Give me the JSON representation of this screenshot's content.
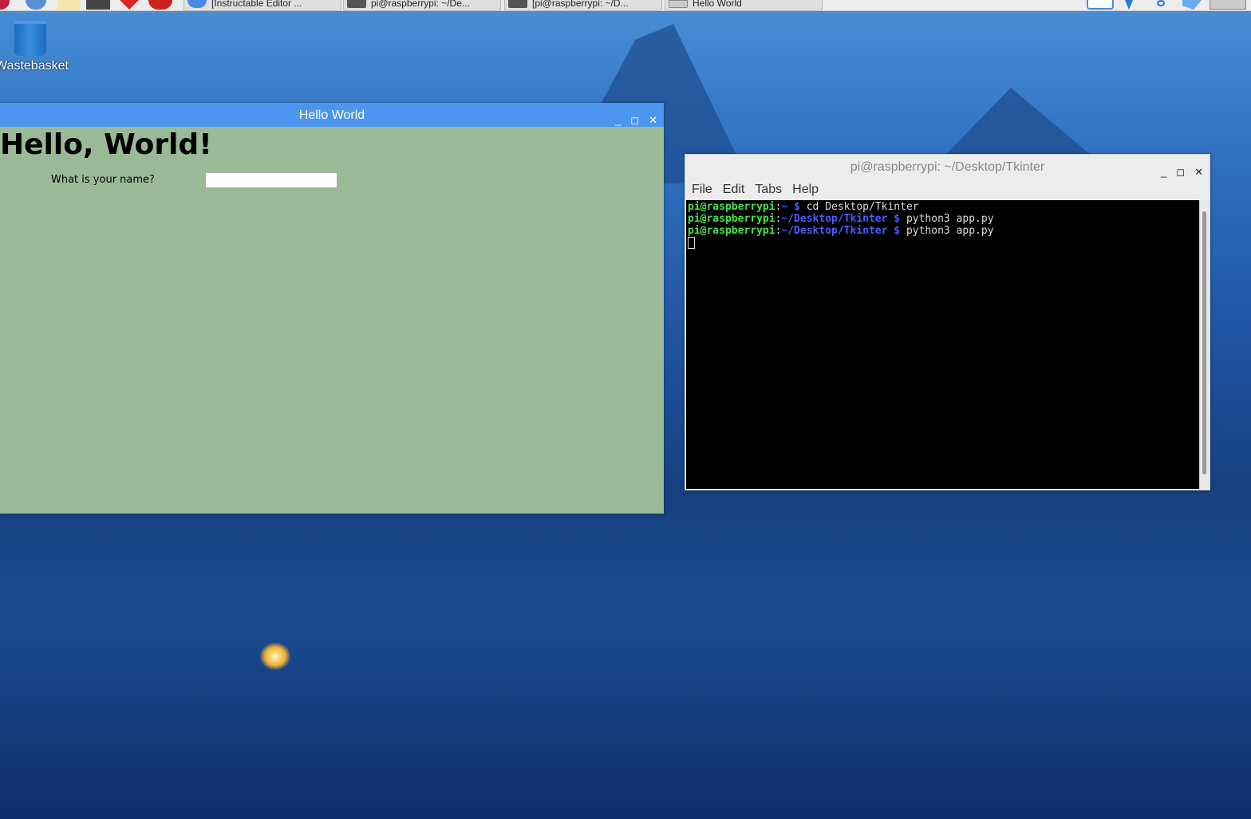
{
  "taskbar": {
    "tasks": [
      "[Instructable Editor ...",
      "pi@raspberrypi: ~/De...",
      "[pi@raspberrypi: ~/D...",
      "Hello World"
    ],
    "tray": [
      "vnc-icon",
      "bluetooth-icon",
      "network-icon",
      "volume-icon",
      "clock"
    ]
  },
  "desktop": {
    "wastebasket": "Wastebasket"
  },
  "hello_window": {
    "title": "Hello World",
    "heading": "Hello, World!",
    "label": "What is your name?",
    "input_value": ""
  },
  "terminal": {
    "title": "pi@raspberrypi: ~/Desktop/Tkinter",
    "menu": [
      "File",
      "Edit",
      "Tabs",
      "Help"
    ],
    "lines": [
      {
        "user": "pi@raspberrypi",
        "path": "~",
        "prompt": "$",
        "cmd": "cd Desktop/Tkinter"
      },
      {
        "user": "pi@raspberrypi",
        "path": "~/Desktop/Tkinter",
        "prompt": "$",
        "cmd": "python3 app.py"
      },
      {
        "user": "pi@raspberrypi",
        "path": "~/Desktop/Tkinter",
        "prompt": "$",
        "cmd": "python3 app.py"
      }
    ]
  }
}
